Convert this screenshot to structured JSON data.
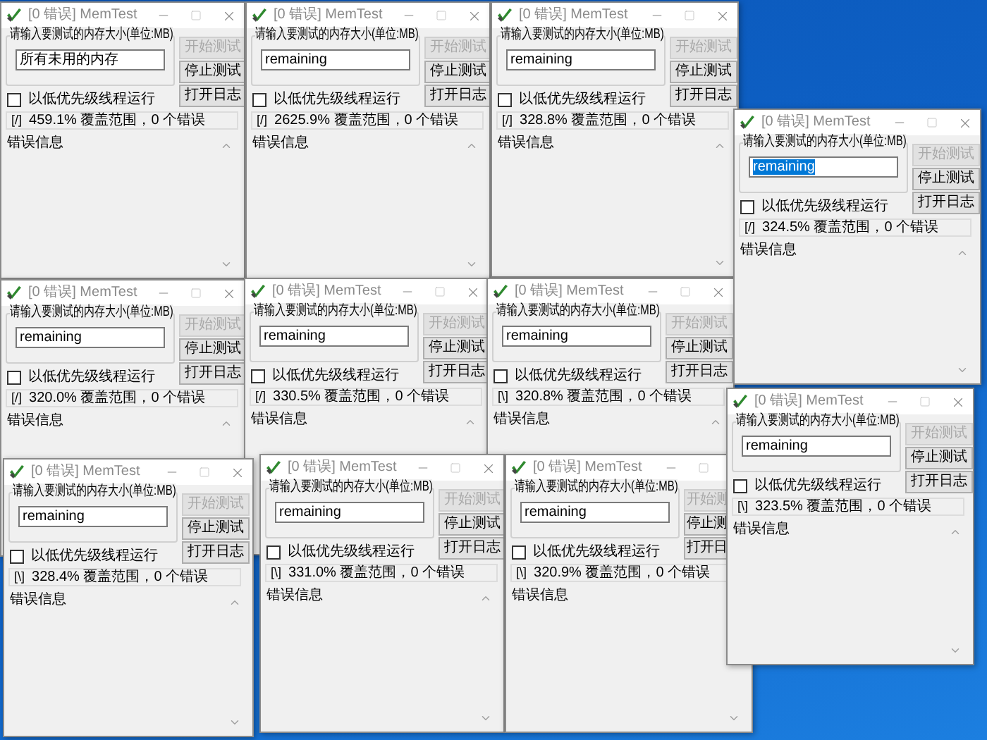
{
  "windows": [
    {
      "title": "[0 错误] MemTest",
      "group_label": "请输入要测试的内存大小(单位:MB)",
      "size_value": "所有未用的内存",
      "value_selected": false,
      "checkbox": {
        "label": "以低优先级线程运行",
        "checked": false
      },
      "buttons": [
        {
          "label": "开始测试",
          "disabled": true
        },
        {
          "label": "停止测试",
          "disabled": false
        },
        {
          "label": "打开日志",
          "disabled": false
        }
      ],
      "buttons_cut": false,
      "spinner": "[/]",
      "status": "459.1% 覆盖范围，0 个错误",
      "log_label": "错误信息"
    },
    {
      "title": "[0 错误] MemTest",
      "group_label": "请输入要测试的内存大小(单位:MB)",
      "size_value": "remaining",
      "value_selected": false,
      "checkbox": {
        "label": "以低优先级线程运行",
        "checked": false
      },
      "buttons": [
        {
          "label": "开始测试",
          "disabled": true
        },
        {
          "label": "停止测试",
          "disabled": false
        },
        {
          "label": "打开日志",
          "disabled": false
        }
      ],
      "buttons_cut": false,
      "spinner": "[/]",
      "status": "2625.9% 覆盖范围，0 个错误",
      "log_label": "错误信息"
    },
    {
      "title": "[0 错误] MemTest",
      "group_label": "请输入要测试的内存大小(单位:MB)",
      "size_value": "remaining",
      "value_selected": false,
      "checkbox": {
        "label": "以低优先级线程运行",
        "checked": false
      },
      "buttons": [
        {
          "label": "开始测试",
          "disabled": true
        },
        {
          "label": "停止测试",
          "disabled": false
        },
        {
          "label": "打开日志",
          "disabled": false
        }
      ],
      "buttons_cut": false,
      "spinner": "[/]",
      "status": "328.8% 覆盖范围，0 个错误",
      "log_label": "错误信息"
    },
    {
      "title": "[0 错误] MemTest",
      "group_label": "请输入要测试的内存大小(单位:MB)",
      "size_value": "remaining",
      "value_selected": true,
      "checkbox": {
        "label": "以低优先级线程运行",
        "checked": false
      },
      "buttons": [
        {
          "label": "开始测试",
          "disabled": true
        },
        {
          "label": "停止测试",
          "disabled": false
        },
        {
          "label": "打开日志",
          "disabled": false
        }
      ],
      "buttons_cut": false,
      "spinner": "[/]",
      "status": "324.5% 覆盖范围，0 个错误",
      "log_label": "错误信息"
    },
    {
      "title": "[0 错误] MemTest",
      "group_label": "请输入要测试的内存大小(单位:MB)",
      "size_value": "remaining",
      "value_selected": false,
      "checkbox": {
        "label": "以低优先级线程运行",
        "checked": false
      },
      "buttons": [
        {
          "label": "开始测试",
          "disabled": true
        },
        {
          "label": "停止测试",
          "disabled": false
        },
        {
          "label": "打开日志",
          "disabled": false
        }
      ],
      "buttons_cut": false,
      "spinner": "[/]",
      "status": "320.0% 覆盖范围，0 个错误",
      "log_label": "错误信息"
    },
    {
      "title": "[0 错误] MemTest",
      "group_label": "请输入要测试的内存大小(单位:MB)",
      "size_value": "remaining",
      "value_selected": false,
      "checkbox": {
        "label": "以低优先级线程运行",
        "checked": false
      },
      "buttons": [
        {
          "label": "开始测试",
          "disabled": true
        },
        {
          "label": "停止测试",
          "disabled": false
        },
        {
          "label": "打开日志",
          "disabled": false
        }
      ],
      "buttons_cut": false,
      "spinner": "[/]",
      "status": "330.5% 覆盖范围，0 个错误",
      "log_label": "错误信息"
    },
    {
      "title": "[0 错误] MemTest",
      "group_label": "请输入要测试的内存大小(单位:MB)",
      "size_value": "remaining",
      "value_selected": false,
      "checkbox": {
        "label": "以低优先级线程运行",
        "checked": false
      },
      "buttons": [
        {
          "label": "开始测试",
          "disabled": true
        },
        {
          "label": "停止测试",
          "disabled": false
        },
        {
          "label": "打开日志",
          "disabled": false
        }
      ],
      "buttons_cut": false,
      "spinner": "[\\]",
      "status": "320.8% 覆盖范围，0 个错误",
      "log_label": "错误信息"
    },
    {
      "title": "[0 错误] MemTest",
      "group_label": "请输入要测试的内存大小(单位:MB)",
      "size_value": "remaining",
      "value_selected": false,
      "checkbox": {
        "label": "以低优先级线程运行",
        "checked": false
      },
      "buttons": [
        {
          "label": "开始测试",
          "disabled": true
        },
        {
          "label": "停止测试",
          "disabled": false
        },
        {
          "label": "打开日志",
          "disabled": false
        }
      ],
      "buttons_cut": false,
      "spinner": "[\\]",
      "status": "323.5% 覆盖范围，0 个错误",
      "log_label": "错误信息"
    },
    {
      "title": "[0 错误] MemTest",
      "group_label": "请输入要测试的内存大小(单位:MB)",
      "size_value": "remaining",
      "value_selected": false,
      "checkbox": {
        "label": "以低优先级线程运行",
        "checked": false
      },
      "buttons": [
        {
          "label": "开始测试",
          "disabled": true
        },
        {
          "label": "停止测试",
          "disabled": false
        },
        {
          "label": "打开日志",
          "disabled": false
        }
      ],
      "buttons_cut": false,
      "spinner": "[\\]",
      "status": "328.4% 覆盖范围，0 个错误",
      "log_label": "错误信息"
    },
    {
      "title": "[0 错误] MemTest",
      "group_label": "请输入要测试的内存大小(单位:MB)",
      "size_value": "remaining",
      "value_selected": false,
      "checkbox": {
        "label": "以低优先级线程运行",
        "checked": false
      },
      "buttons": [
        {
          "label": "开始测试",
          "disabled": true
        },
        {
          "label": "停止测试",
          "disabled": false
        },
        {
          "label": "打开日志",
          "disabled": false
        }
      ],
      "buttons_cut": false,
      "spinner": "[\\]",
      "status": "331.0% 覆盖范围，0 个错误",
      "log_label": "错误信息"
    },
    {
      "title": "[0 错误] MemTest",
      "group_label": "请输入要测试的内存大小(单位:MB)",
      "size_value": "remaining",
      "value_selected": false,
      "checkbox": {
        "label": "以低优先级线程运行",
        "checked": false
      },
      "buttons": [
        {
          "label": "开始测",
          "disabled": true
        },
        {
          "label": "停止测",
          "disabled": false
        },
        {
          "label": "打开日",
          "disabled": false
        }
      ],
      "buttons_cut": true,
      "spinner": "[\\]",
      "status": "320.9% 覆盖范围，0 个错误",
      "log_label": "错误信息"
    }
  ]
}
